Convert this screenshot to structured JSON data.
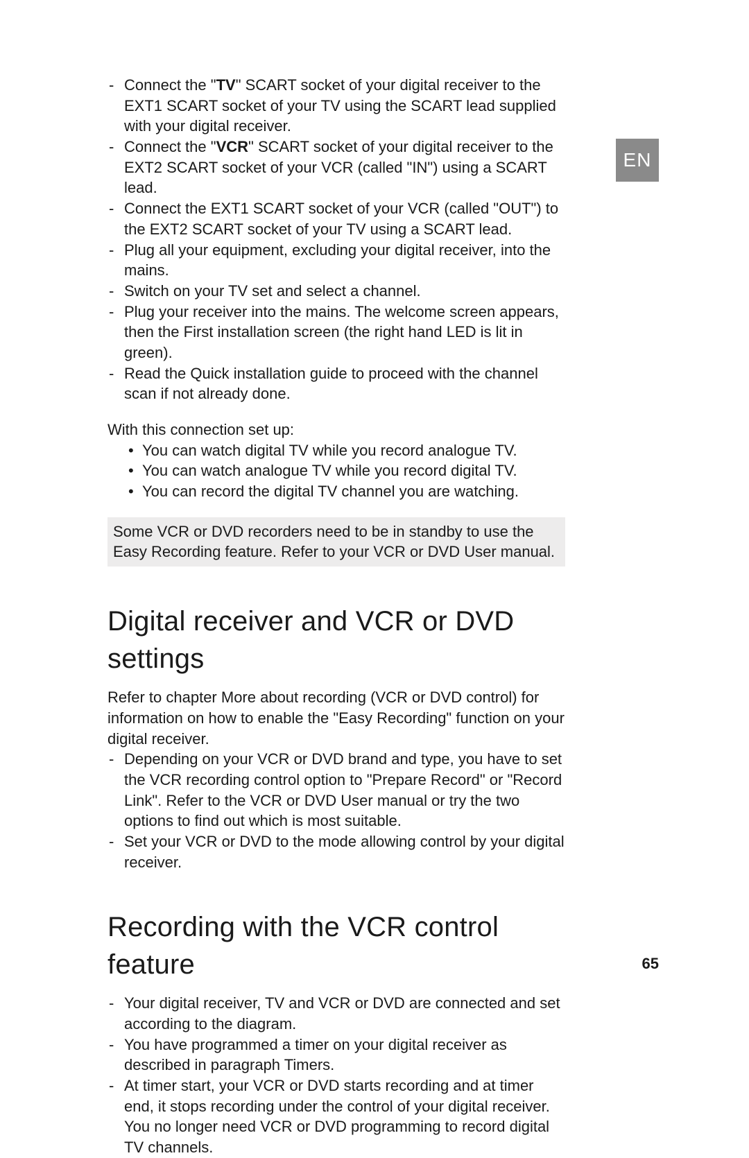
{
  "lang_tab": "EN",
  "page_number": "65",
  "intro_list": [
    {
      "pre": "Connect the \"",
      "bold": "TV",
      "post": "\" SCART socket of your digital receiver to the EXT1 SCART socket of your TV using the SCART lead supplied with your digital receiver."
    },
    {
      "pre": "Connect the \"",
      "bold": "VCR",
      "post": "\" SCART socket of your digital receiver to the EXT2 SCART socket of your VCR (called \"IN\") using a SCART lead."
    },
    {
      "text": "Connect the EXT1 SCART socket of your VCR (called \"OUT\") to the EXT2 SCART socket of your TV using a SCART lead."
    },
    {
      "text": "Plug all your equipment, excluding your digital receiver, into the mains."
    },
    {
      "text": "Switch on your TV set and select a channel."
    },
    {
      "text": "Plug your receiver into the mains. The welcome screen appears, then the First installation screen (the right hand LED is lit in green)."
    },
    {
      "text": "Read the Quick installation guide to proceed with the channel scan if not already done."
    }
  ],
  "connection_intro": "With this connection set up:",
  "connection_bullets": [
    "You can watch digital TV while you record analogue TV.",
    "You can watch analogue TV while you record digital TV.",
    "You can record the digital TV channel you are watching."
  ],
  "note_box": "Some VCR or DVD recorders need to be in standby to use the Easy Recording feature. Refer to your VCR or DVD User manual.",
  "section1": {
    "title": "Digital receiver and VCR or DVD settings",
    "para": "Refer to chapter More about recording (VCR or DVD control) for information on how to enable the \"Easy Recording\" function on your digital receiver.",
    "list": [
      "Depending on your VCR or DVD brand and type, you have to set the VCR recording control option to \"Prepare Record\" or \"Record Link\". Refer to the VCR or DVD User manual or try the two options to find out which is most suitable.",
      "Set your VCR or DVD to the mode allowing control by your digital receiver."
    ]
  },
  "section2": {
    "title": "Recording with the VCR control feature",
    "list": [
      "Your digital receiver, TV and VCR or DVD are connected and set according to the diagram.",
      "You have programmed a timer on your digital receiver as described in paragraph Timers.",
      "At timer start, your VCR or DVD starts recording and at timer end, it stops recording under the control of your digital receiver. You no longer need VCR or DVD programming to record digital TV channels."
    ]
  }
}
